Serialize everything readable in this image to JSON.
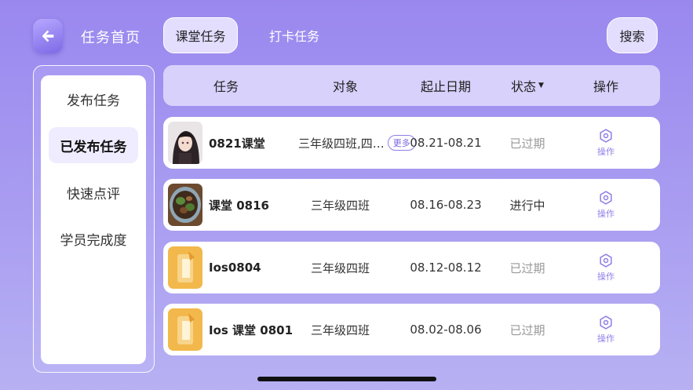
{
  "header": {
    "home_title": "任务首页",
    "tabs": [
      {
        "label": "课堂任务",
        "active": true
      },
      {
        "label": "打卡任务",
        "active": false
      }
    ],
    "search_label": "搜索"
  },
  "sidebar": {
    "items": [
      {
        "label": "发布任务",
        "active": false
      },
      {
        "label": "已发布任务",
        "active": true
      },
      {
        "label": "快速点评",
        "active": false
      },
      {
        "label": "学员完成度",
        "active": false
      }
    ]
  },
  "table": {
    "columns": {
      "task": "任务",
      "target": "对象",
      "date": "起止日期",
      "status": "状态",
      "action": "操作"
    },
    "rows": [
      {
        "name": "0821课堂",
        "target": "三年级四班,四…",
        "more": "更多",
        "date": "08.21-08.21",
        "status": "已过期",
        "action": "操作",
        "thumb": "anime-avatar"
      },
      {
        "name": "课堂 0816",
        "target": "三年级四班",
        "date": "08.16-08.23",
        "status": "进行中",
        "action": "操作",
        "thumb": "food-photo"
      },
      {
        "name": "Ios0804",
        "target": "三年级四班",
        "date": "08.12-08.12",
        "status": "已过期",
        "action": "操作",
        "thumb": "app-logo"
      },
      {
        "name": "Ios 课堂 0801",
        "target": "三年级四班",
        "date": "08.02-08.06",
        "status": "已过期",
        "action": "操作",
        "thumb": "app-logo"
      }
    ]
  },
  "colors": {
    "accent": "#8f7de8",
    "background": "#9a88ef",
    "expired": "#999999"
  }
}
